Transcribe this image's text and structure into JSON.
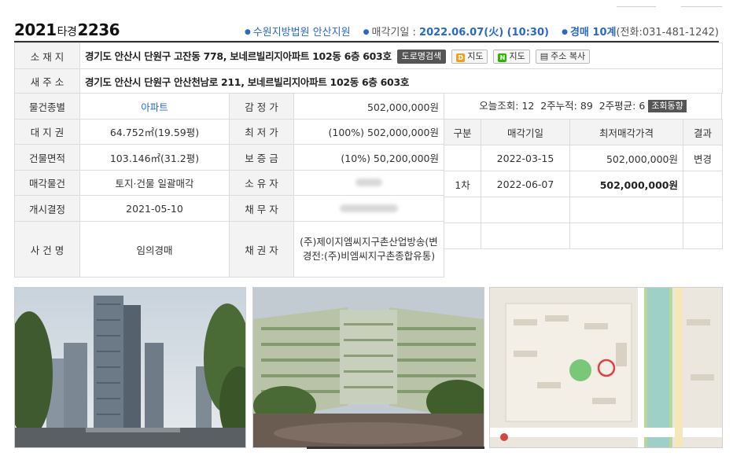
{
  "header": {
    "case_year": "2021",
    "case_type": "타경",
    "case_no": "2236",
    "court": "수원지방법원 안산지원",
    "sale_date_label": "매각기일 :",
    "sale_date": "2022.06.07(火) (10:30)",
    "dept": "경매 10계",
    "phone": "(전화:031-481-1242)"
  },
  "property": {
    "location_label": "소 재 지",
    "location": "경기도 안산시 단원구 고잔동 778, 보네르빌리지아파트 102동 6층 603호",
    "road_search_btn": "도로명검색",
    "map1_btn": "지도",
    "map2_btn": "지도",
    "copy_btn": "주소 복사",
    "new_address_label": "새 주 소",
    "new_address": "경기도 안산시 단원구 안산천남로 211, 보네르빌리지아파트 102동 6층 603호",
    "type_label": "물건종별",
    "type": "아파트",
    "land_label": "대 지 권",
    "land": "64.752㎡(19.59평)",
    "building_label": "건물면적",
    "building": "103.146㎡(31.2평)",
    "sale_item_label": "매각물건",
    "sale_item": "토지·건물 일괄매각",
    "start_label": "개시결정",
    "start": "2021-05-10",
    "case_name_label": "사 건 명",
    "case_name": "임의경매",
    "appraisal_label": "감 정 가",
    "appraisal": "502,000,000원",
    "min_label": "최 저 가",
    "min": "(100%) 502,000,000원",
    "deposit_label": "보 증 금",
    "deposit": "(10%) 50,200,000원",
    "owner_label": "소 유 자",
    "debtor_label": "채 무 자",
    "creditor_label": "채 권 자",
    "creditor": "(주)제이지엠씨지구촌산업방송(변경전:(주)비엠씨지구촌종합유통)"
  },
  "views": {
    "text": "오늘조회: 12  2주누적: 89  2주평균: 6",
    "btn": "조회동향"
  },
  "history": {
    "headers": [
      "구분",
      "매각기일",
      "최저매각가격",
      "결과"
    ],
    "rows": [
      {
        "round": "",
        "date": "2022-03-15",
        "price": "502,000,000원",
        "result": "변경"
      },
      {
        "round": "1차",
        "date": "2022-06-07",
        "price": "502,000,000원",
        "result": ""
      }
    ]
  }
}
